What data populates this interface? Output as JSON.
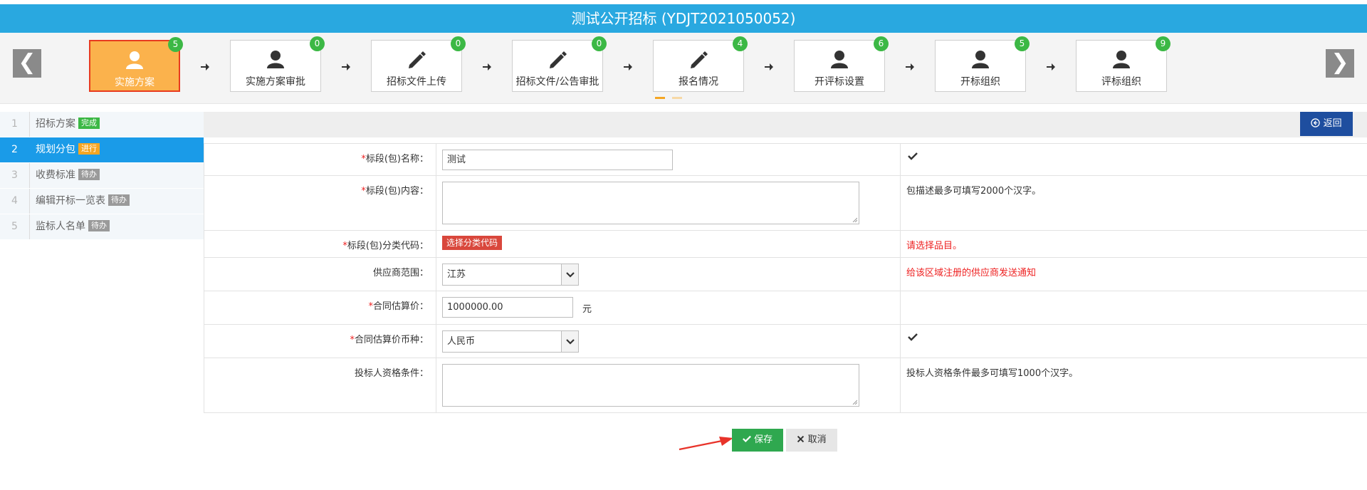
{
  "header": {
    "title": "测试公开招标 (YDJT2021050052)"
  },
  "steps": [
    {
      "label": "实施方案",
      "badge": "5",
      "icon": "user-icon"
    },
    {
      "label": "实施方案审批",
      "badge": "0",
      "icon": "user-icon"
    },
    {
      "label": "招标文件上传",
      "badge": "0",
      "icon": "pencil-icon"
    },
    {
      "label": "招标文件/公告审批",
      "badge": "0",
      "icon": "pencil-icon"
    },
    {
      "label": "报名情况",
      "badge": "4",
      "icon": "pencil-icon"
    },
    {
      "label": "开评标设置",
      "badge": "6",
      "icon": "user-icon"
    },
    {
      "label": "开标组织",
      "badge": "5",
      "icon": "user-icon"
    },
    {
      "label": "评标组织",
      "badge": "9",
      "icon": "user-icon"
    }
  ],
  "nav": {
    "prev": "❮",
    "next": "❯"
  },
  "sidebar": {
    "items": [
      {
        "num": "1",
        "name": "招标方案",
        "tag": "完成",
        "tag_color": "#3cb845"
      },
      {
        "num": "2",
        "name": "规划分包",
        "tag": "进行",
        "tag_color": "#f5a623"
      },
      {
        "num": "3",
        "name": "收费标准",
        "tag": "待办",
        "tag_color": "#9a9a9a"
      },
      {
        "num": "4",
        "name": "编辑开标一览表",
        "tag": "待办",
        "tag_color": "#9a9a9a"
      },
      {
        "num": "5",
        "name": "监标人名单",
        "tag": "待办",
        "tag_color": "#9a9a9a"
      }
    ]
  },
  "toolbar": {
    "back_label": "返回"
  },
  "form": {
    "name": {
      "label": "标段(包)名称：",
      "value": "测试"
    },
    "content": {
      "label": "标段(包)内容：",
      "hint": "包描述最多可填写2000个汉字。"
    },
    "code": {
      "label": "标段(包)分类代码：",
      "button": "选择分类代码",
      "hint": "请选择品目。"
    },
    "scope": {
      "label": "供应商范围：",
      "value": "江苏",
      "hint": "给该区域注册的供应商发送通知"
    },
    "price": {
      "label": "合同估算价：",
      "value": "1000000.00",
      "unit": "元"
    },
    "currency": {
      "label": "合同估算价币种：",
      "value": "人民币"
    },
    "qualification": {
      "label": "投标人资格条件：",
      "hint": "投标人资格条件最多可填写1000个汉字。"
    },
    "required_mark": "*"
  },
  "actions": {
    "save_label": "保存",
    "cancel_label": "取消"
  },
  "colors": {
    "header": "#29a8e0",
    "active_step": "#fbb24c",
    "sidebar_active": "#1a9be8",
    "save": "#2fa84f",
    "back": "#1e4e9f"
  }
}
